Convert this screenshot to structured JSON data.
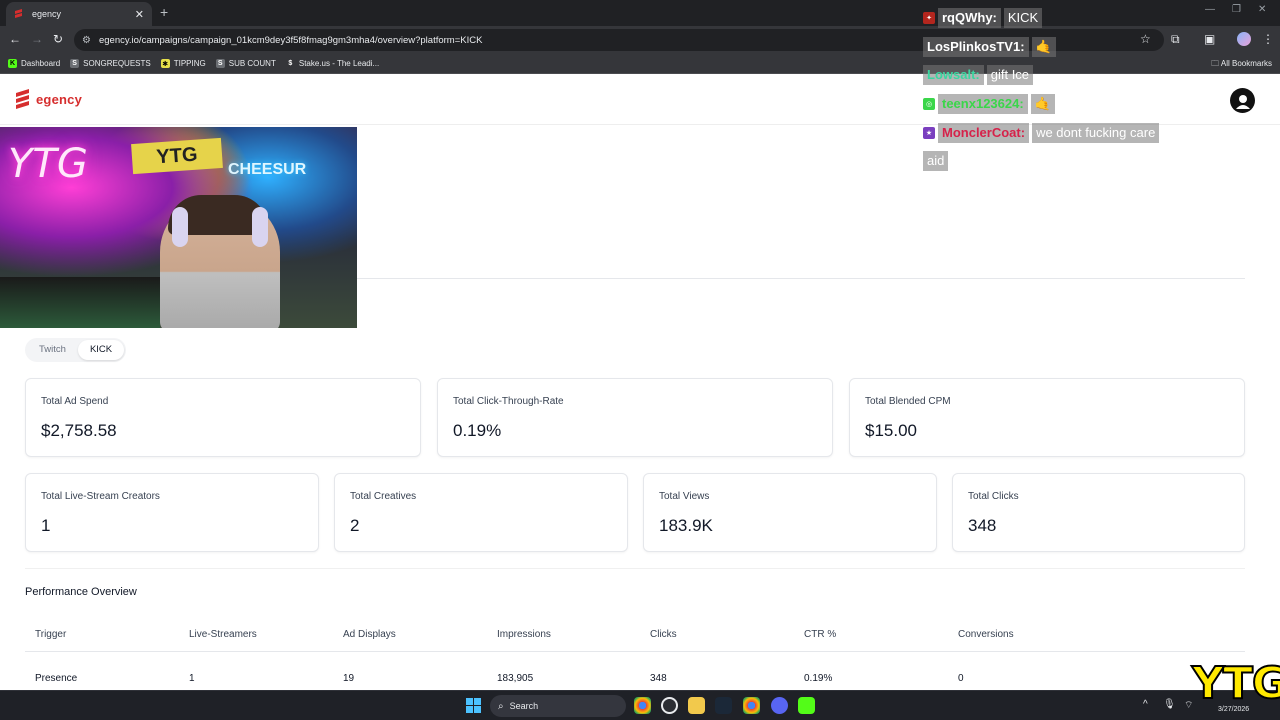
{
  "browser": {
    "tab_title": "egency",
    "new_tab": "+",
    "close_tab": "✕",
    "url": "egency.io/campaigns/campaign_01kcm9dey3f5f8fmag9gm3mha4/overview?platform=KICK",
    "bookmarks": [
      {
        "label": "Dashboard",
        "icon": "kick-icon",
        "color": "#53fc18"
      },
      {
        "label": "SONGREQUESTS",
        "icon": "songrequest-icon",
        "color": "#9aa0a6"
      },
      {
        "label": "TIPPING",
        "icon": "tipping-icon",
        "color": "#e6e04a"
      },
      {
        "label": "SUB COUNT",
        "icon": "subcount-icon",
        "color": "#9aa0a6"
      },
      {
        "label": "Stake.us - The Leadi...",
        "icon": "stake-icon",
        "color": "#ffffff"
      }
    ],
    "all_bookmarks": "All Bookmarks"
  },
  "site": {
    "logo_text": "egency",
    "brand_color": "#d62e2e"
  },
  "platform_toggle": {
    "options": [
      "Twitch",
      "KICK"
    ],
    "selected": "KICK"
  },
  "stats": {
    "total_ad_spend": {
      "label": "Total Ad Spend",
      "value": "$2,758.58"
    },
    "total_ctr": {
      "label": "Total Click-Through-Rate",
      "value": "0.19%"
    },
    "total_cpm": {
      "label": "Total Blended CPM",
      "value": "$15.00"
    },
    "total_creators": {
      "label": "Total Live-Stream Creators",
      "value": "1"
    },
    "total_creatives": {
      "label": "Total Creatives",
      "value": "2"
    },
    "total_views": {
      "label": "Total Views",
      "value": "183.9K"
    },
    "total_clicks": {
      "label": "Total Clicks",
      "value": "348"
    }
  },
  "performance": {
    "title": "Performance Overview",
    "columns": [
      "Trigger",
      "Live-Streamers",
      "Ad Displays",
      "Impressions",
      "Clicks",
      "CTR %",
      "Conversions"
    ],
    "rows": [
      [
        "Presence",
        "1",
        "19",
        "183,905",
        "348",
        "0.19%",
        "0"
      ]
    ]
  },
  "stream_overlay": {
    "chat": [
      {
        "user": "rqQWhy:",
        "text": "KICK",
        "color": "#ffffff",
        "badge_color": "#b3261e"
      },
      {
        "user": "LosPlinkosTV1:",
        "text": "🤙",
        "color": "#ffffff",
        "badge_color": ""
      },
      {
        "user": "Lowsalt:",
        "text": "gift Ice",
        "color": "#3ad6a0",
        "badge_color": ""
      },
      {
        "user": "teenx123624:",
        "text": "🤙",
        "color": "#3ad64a",
        "badge_color": "#3ad64a"
      },
      {
        "user": "MonclerCoat:",
        "text": "we dont fucking care",
        "color": "#d6224a",
        "badge_color": "#7a3fbf"
      },
      {
        "user": "",
        "text": "aid",
        "color": "#ffffff",
        "badge_color": ""
      }
    ],
    "logo_text": "YTG",
    "webcam_text": {
      "neon": "YTG",
      "flag": "YTG",
      "sign": "CHEESUR"
    }
  },
  "taskbar": {
    "search_placeholder": "Search",
    "date": "3/27/2026"
  }
}
